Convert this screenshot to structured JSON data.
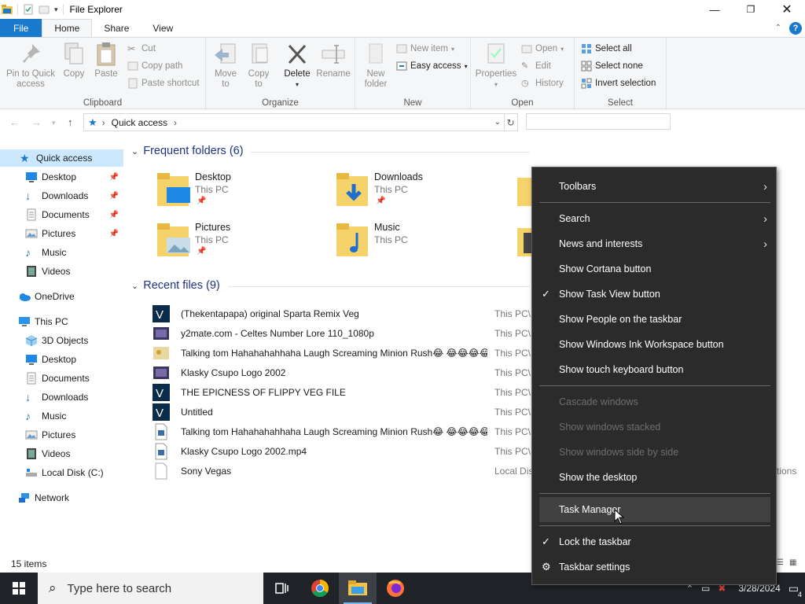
{
  "window": {
    "title": "File Explorer",
    "controls": [
      "minimize-icon",
      "maximize-icon",
      "close-icon"
    ]
  },
  "ribbon_tabs": [
    "File",
    "Home",
    "Share",
    "View"
  ],
  "ribbon": {
    "clipboard": {
      "label": "Clipboard",
      "pin": "Pin to Quick access",
      "copy": "Copy",
      "paste": "Paste",
      "cut": "Cut",
      "copy_path": "Copy path",
      "paste_shortcut": "Paste shortcut"
    },
    "organize": {
      "label": "Organize",
      "move_to": "Move to",
      "copy_to": "Copy to",
      "delete": "Delete",
      "rename": "Rename"
    },
    "new": {
      "label": "New",
      "new_folder": "New folder",
      "new_item": "New item",
      "easy_access": "Easy access"
    },
    "open": {
      "label": "Open",
      "properties": "Properties",
      "open": "Open",
      "edit": "Edit",
      "history": "History"
    },
    "select": {
      "label": "Select",
      "select_all": "Select all",
      "select_none": "Select none",
      "invert_selection": "Invert selection"
    }
  },
  "address": {
    "crumb": "Quick access",
    "search_placeholder": ""
  },
  "nav": [
    {
      "label": "Quick access",
      "icon": "star-icon",
      "sel": true,
      "indent": 0
    },
    {
      "label": "Desktop",
      "icon": "desktop-icon",
      "pin": true,
      "indent": 1
    },
    {
      "label": "Downloads",
      "icon": "download-icon",
      "pin": true,
      "indent": 1
    },
    {
      "label": "Documents",
      "icon": "documents-icon",
      "pin": true,
      "indent": 1
    },
    {
      "label": "Pictures",
      "icon": "pictures-icon",
      "pin": true,
      "indent": 1
    },
    {
      "label": "Music",
      "icon": "music-icon",
      "indent": 1
    },
    {
      "label": "Videos",
      "icon": "videos-icon",
      "indent": 1
    },
    {
      "label": "OneDrive",
      "icon": "cloud-icon",
      "indent": 0
    },
    {
      "label": "This PC",
      "icon": "computer-icon",
      "indent": 0
    },
    {
      "label": "3D Objects",
      "icon": "cube-icon",
      "indent": 1
    },
    {
      "label": "Desktop",
      "icon": "desktop-icon",
      "indent": 1
    },
    {
      "label": "Documents",
      "icon": "documents-icon",
      "indent": 1
    },
    {
      "label": "Downloads",
      "icon": "download-icon",
      "indent": 1
    },
    {
      "label": "Music",
      "icon": "music-icon",
      "indent": 1
    },
    {
      "label": "Pictures",
      "icon": "pictures-icon",
      "indent": 1
    },
    {
      "label": "Videos",
      "icon": "videos-icon",
      "indent": 1
    },
    {
      "label": "Local Disk (C:)",
      "icon": "drive-icon",
      "indent": 1
    },
    {
      "label": "Network",
      "icon": "network-icon",
      "indent": 0
    }
  ],
  "frequent": {
    "title": "Frequent folders (6)",
    "items": [
      {
        "name": "Desktop",
        "sub": "This PC",
        "pinned": true
      },
      {
        "name": "Downloads",
        "sub": "This PC",
        "pinned": true
      },
      {
        "name": "Pictures",
        "sub": "This PC",
        "pinned": true
      },
      {
        "name": "Music",
        "sub": "This PC",
        "pinned": false
      }
    ]
  },
  "recent": {
    "title": "Recent files (9)",
    "files": [
      {
        "name": "(Thekentapapa) original Sparta Remix Veg",
        "path": "This PC\\",
        "icon": "vegas-project-icon"
      },
      {
        "name": "y2mate.com - Celtes Number Lore 110_1080p",
        "path": "This PC\\",
        "icon": "video-file-icon"
      },
      {
        "name": "Talking tom Hahahahahhaha Laugh Screaming Minion Rush😂 😂😂😂😂...",
        "path": "This PC\\",
        "icon": "image-file-icon"
      },
      {
        "name": "Klasky Csupo Logo 2002",
        "path": "This PC\\",
        "icon": "video-file-icon"
      },
      {
        "name": "THE EPICNESS OF FLIPPY VEG FILE",
        "path": "This PC\\",
        "icon": "vegas-project-icon"
      },
      {
        "name": "Untitled",
        "path": "This PC\\",
        "icon": "vegas-project-icon"
      },
      {
        "name": "Talking tom Hahahahahhaha Laugh Screaming Minion Rush😂 😂😂😂😂...",
        "path": "This PC\\",
        "icon": "media-file-icon"
      },
      {
        "name": "Klasky Csupo Logo 2002.mp4",
        "path": "This PC\\",
        "icon": "media-file-icon"
      },
      {
        "name": "Sony Vegas",
        "path": "Local Dis",
        "icon": "blank-file-icon"
      }
    ]
  },
  "status": {
    "items": "15 items"
  },
  "context_menu": {
    "items": [
      {
        "label": "Toolbars",
        "submenu": true
      },
      {
        "sep": true
      },
      {
        "label": "Search",
        "submenu": true
      },
      {
        "label": "News and interests",
        "submenu": true
      },
      {
        "label": "Show Cortana button"
      },
      {
        "label": "Show Task View button",
        "checked": true
      },
      {
        "label": "Show People on the taskbar"
      },
      {
        "label": "Show Windows Ink Workspace button"
      },
      {
        "label": "Show touch keyboard button"
      },
      {
        "sep": true
      },
      {
        "label": "Cascade windows",
        "disabled": true
      },
      {
        "label": "Show windows stacked",
        "disabled": true
      },
      {
        "label": "Show windows side by side",
        "disabled": true
      },
      {
        "label": "Show the desktop"
      },
      {
        "sep": true
      },
      {
        "label": "Task Manager",
        "hover": true
      },
      {
        "sep": true
      },
      {
        "label": "Lock the taskbar",
        "checked": true
      },
      {
        "label": "Taskbar settings",
        "gear": true
      }
    ]
  },
  "taskbar": {
    "search_placeholder": "Type here to search",
    "clock_date": "3/28/2024",
    "notif_count": "4",
    "peek_text": "tions"
  }
}
